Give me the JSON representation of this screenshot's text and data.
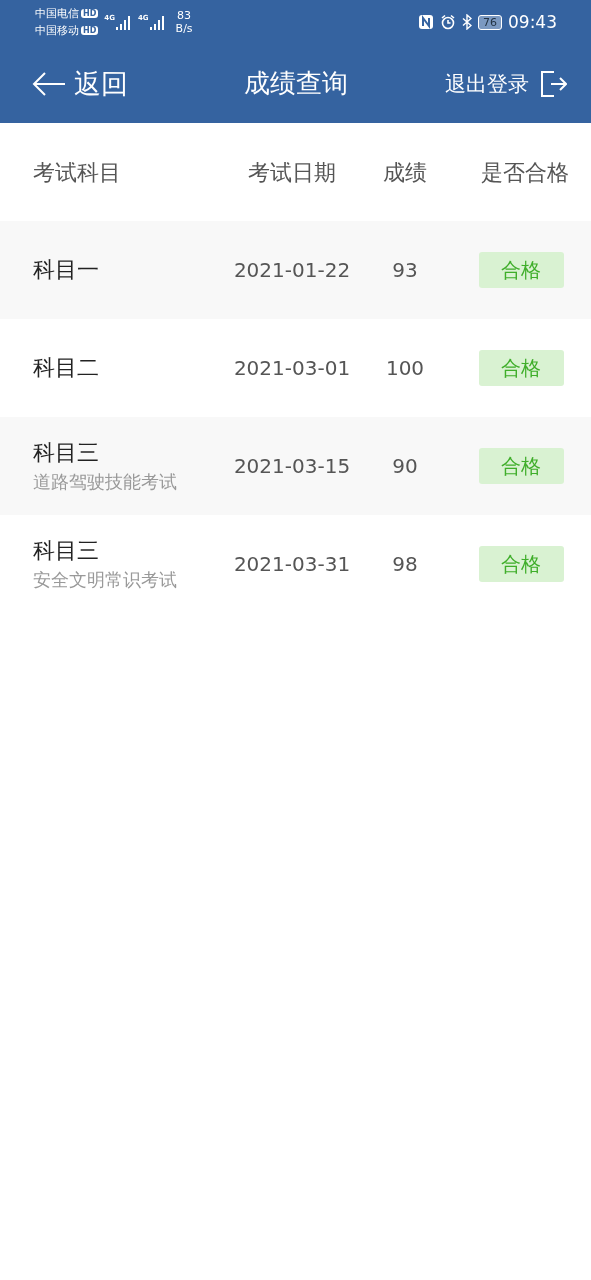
{
  "status_bar": {
    "carriers": [
      {
        "name": "中国电信",
        "badge": "HD"
      },
      {
        "name": "中国移动",
        "badge": "HD"
      }
    ],
    "networks": [
      "4G",
      "4G"
    ],
    "speed_value": "83",
    "speed_unit": "B/s",
    "battery": "76",
    "time": "09:43"
  },
  "header": {
    "back": "返回",
    "title": "成绩查询",
    "logout": "退出登录"
  },
  "table": {
    "columns": [
      "考试科目",
      "考试日期",
      "成绩",
      "是否合格"
    ],
    "rows": [
      {
        "subject": "科目一",
        "date": "2021-01-22",
        "score": "93",
        "result": "合格",
        "passed": true
      },
      {
        "subject": "科目二",
        "date": "2021-03-01",
        "score": "100",
        "result": "合格",
        "passed": true
      },
      {
        "subject": "科目三",
        "detail": "道路驾驶技能考试",
        "date": "2021-03-15",
        "score": "90",
        "result": "合格",
        "passed": true
      },
      {
        "subject": "科目三",
        "detail": "安全文明常识考试",
        "date": "2021-03-31",
        "score": "98",
        "result": "合格",
        "passed": true
      }
    ]
  }
}
